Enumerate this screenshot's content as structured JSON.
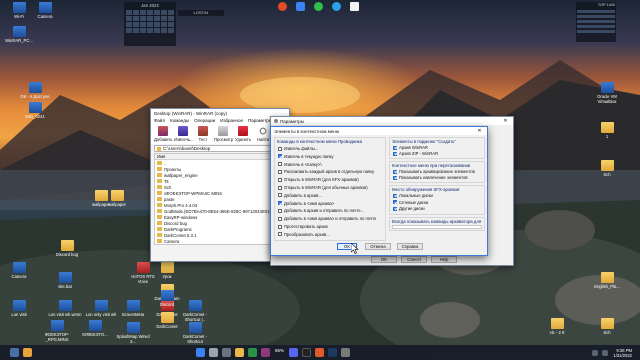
{
  "desktop_icons": [
    {
      "label": "Wi-Fi",
      "kind": "app"
    },
    {
      "label": "Camera",
      "kind": "app"
    },
    {
      "label": "WinRAR_PC...",
      "kind": "app"
    },
    {
      "label": "OK - в Доступе",
      "kind": "app"
    },
    {
      "label": "IMG_0241",
      "kind": "app"
    },
    {
      "label": "Discord bug",
      "kind": "folder"
    },
    {
      "label": "wallpaper",
      "kind": "folder"
    },
    {
      "label": "wallpaper",
      "kind": "folder"
    },
    {
      "label": "Camera",
      "kind": "app"
    },
    {
      "label": "Lon visit",
      "kind": "app"
    },
    {
      "label": "site.bat",
      "kind": "app"
    },
    {
      "label": "Lon visit wh.wmm",
      "kind": "app"
    },
    {
      "label": "Lon only visit wh",
      "kind": "app"
    },
    {
      "label": "ScreenMeta",
      "kind": "app"
    },
    {
      "label": "HoTOS RTS Voice",
      "kind": "red"
    },
    {
      "label": "SplashMap Wired 3...",
      "kind": "app"
    },
    {
      "label": "DarkComet",
      "kind": "red"
    },
    {
      "label": "DarkComet - Shortcut (..",
      "kind": "app"
    },
    {
      "label": "DarkComet - Shortcut",
      "kind": "app"
    },
    {
      "label": "Урок",
      "kind": "folder"
    },
    {
      "label": "ФОЕКЭТОР-_RPG.MINS",
      "kind": "app"
    },
    {
      "label": "КЯ0ЕКЭТО...",
      "kind": "app"
    },
    {
      "label": "Oracle VM VirtualBox",
      "kind": "app"
    },
    {
      "label": "DarkProgram",
      "kind": "folder"
    },
    {
      "label": "Discord",
      "kind": "app"
    },
    {
      "label": "DarkComet",
      "kind": "folder"
    },
    {
      "label": "1",
      "kind": "folder"
    },
    {
      "label": "Sch",
      "kind": "folder"
    },
    {
      "label": "English_Pla...",
      "kind": "folder"
    },
    {
      "label": "Sch",
      "kind": "folder"
    },
    {
      "label": "vlc - 2 9",
      "kind": "folder"
    }
  ],
  "widgets": {
    "calendar_month": "Jan 2022",
    "top_text": "LOST04",
    "top_right": "TOP 1400"
  },
  "winrar_window": {
    "title": "Desktop (WinRAR) - WinRAR (copy)",
    "menu": [
      "Файл",
      "Команды",
      "Операции",
      "Избранное",
      "Параметры",
      "Справка"
    ],
    "tools": [
      "Добавить",
      "Извлечь...",
      "Тест",
      "Просмотр",
      "Удалить",
      "Найти"
    ],
    "path": "C:\\Users\\basel\\Desktop",
    "column_name": "Имя",
    "files": [
      "..",
      "Проекты",
      "wallpaper_engine",
      "Tit",
      "Sch",
      "xФОЕКЭТОР-WPMAIIC MINS",
      "paste",
      "Morph.Pro 4.4.03",
      "GodMode.{ED7BA470-8E54-465E-825C-99712043E01C}",
      "EasyRP-windows",
      "Discord bug",
      "DarkPrograms",
      "DarkComet 5.3.1",
      "Camera"
    ]
  },
  "options_dialog": {
    "title": "Элементы в контекстном меню",
    "left_group_title": "Команды в контекстном меню Проводника",
    "left_items": [
      {
        "label": "Извлечь файлы...",
        "checked": false
      },
      {
        "label": "Извлечь в текущую папку",
        "checked": true
      },
      {
        "label": "Извлечь в <папку>\\",
        "checked": false
      },
      {
        "label": "Распаковать каждый архив в отдельную папку",
        "checked": false
      },
      {
        "label": "Открыть в WinRAR (для SFX-архивов)",
        "checked": false
      },
      {
        "label": "Открыть в WinRAR (для обычных архивов)",
        "checked": false
      },
      {
        "label": "Добавить в архив...",
        "checked": false
      },
      {
        "label": "Добавить в <имя архива>",
        "checked": true
      },
      {
        "label": "Добавить в архив и отправить по почте...",
        "checked": false
      },
      {
        "label": "Добавить в <имя архива> и отправить по почте",
        "checked": false
      },
      {
        "label": "Протестировать архив",
        "checked": false
      },
      {
        "label": "Преобразовать архив...",
        "checked": false
      }
    ],
    "right_group1_title": "Элементы в подменю \"Создать\"",
    "right_group1_items": [
      {
        "label": "Архив WinRAR",
        "checked": true
      },
      {
        "label": "Архив ZIP - WinRAR",
        "checked": true
      }
    ],
    "right_group2_title": "Контекстное меню при перетаскивании",
    "right_group2_items": [
      {
        "label": "Показывать архивирование элементов",
        "checked": true
      },
      {
        "label": "Показывать извлечение элементов",
        "checked": true
      }
    ],
    "right_group3_title": "Место обнаружения SFX-архивов",
    "right_group3_items": [
      {
        "label": "Локальные диски",
        "checked": true
      },
      {
        "label": "Сетевые диски",
        "checked": true
      },
      {
        "label": "Другие диски",
        "checked": true
      }
    ],
    "bottom_group_title": "Всегда показывать команды архиватора для",
    "buttons": {
      "ok": "OK",
      "cancel": "Отмена",
      "help": "Справка"
    }
  },
  "params_window": {
    "title": "Параметры",
    "buttons": {
      "ok": "OK",
      "cancel": "Cancel",
      "help": "Help"
    }
  },
  "taskbar": {
    "weather": "86%",
    "time": "9:36 PM",
    "date": "1/31/2022"
  }
}
